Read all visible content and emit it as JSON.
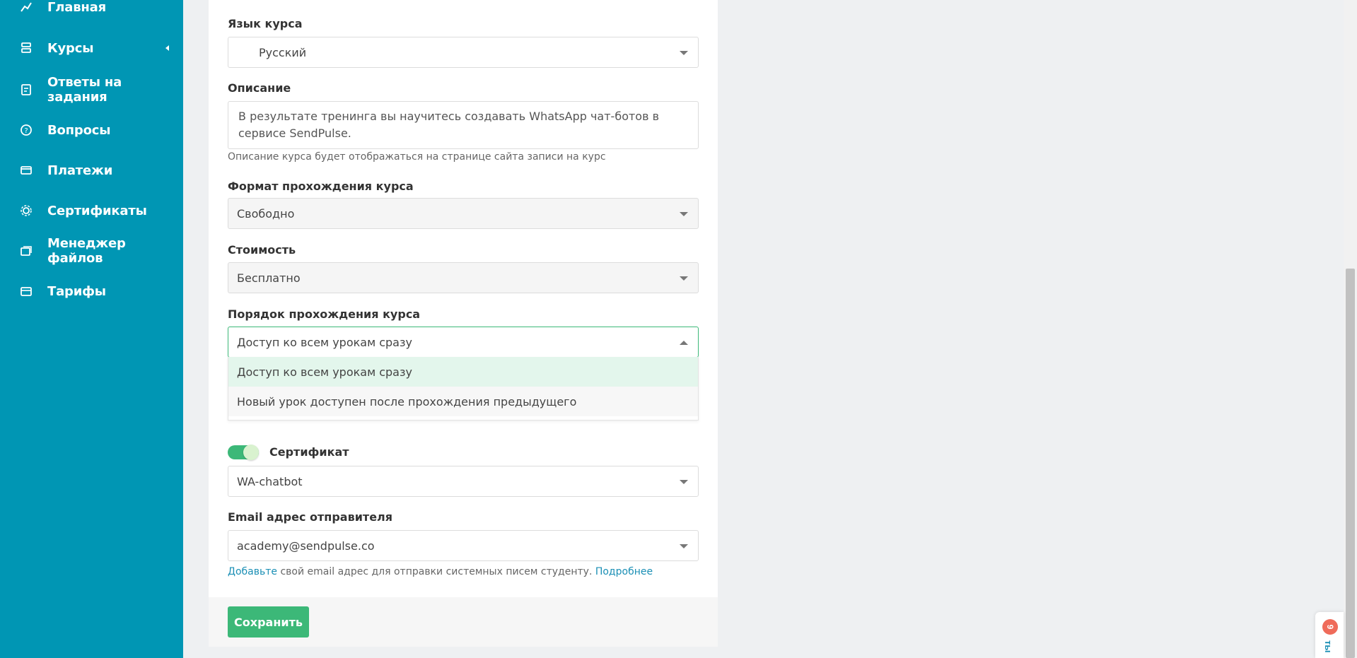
{
  "sidebar": {
    "items": [
      {
        "label": "Главная",
        "icon": "chart-line-icon"
      },
      {
        "label": "Курсы",
        "icon": "courses-icon"
      },
      {
        "label": "Ответы на задания",
        "icon": "answers-icon"
      },
      {
        "label": "Вопросы",
        "icon": "question-icon"
      },
      {
        "label": "Платежи",
        "icon": "payments-icon"
      },
      {
        "label": "Сертификаты",
        "icon": "certificate-icon"
      },
      {
        "label": "Менеджер файлов",
        "icon": "files-icon"
      },
      {
        "label": "Тарифы",
        "icon": "tariffs-icon"
      }
    ]
  },
  "form": {
    "language": {
      "label": "Язык курса",
      "value": "Русский"
    },
    "description": {
      "label": "Описание",
      "value": "В результате тренинга вы научитесь создавать WhatsApp чат-ботов в сервисе SendPulse.",
      "hint": "Описание курса будет отображаться на странице сайта записи на курс"
    },
    "format": {
      "label": "Формат прохождения курса",
      "value": "Свободно"
    },
    "price": {
      "label": "Стоимость",
      "value": "Бесплатно"
    },
    "order": {
      "label": "Порядок прохождения курса",
      "value": "Доступ ко всем урокам сразу",
      "options": [
        "Доступ ко всем урокам сразу",
        "Новый урок доступен после прохождения предыдущего"
      ]
    },
    "certificate": {
      "label": "Сертификат",
      "enabled": true,
      "value": "WA-chatbot"
    },
    "sender": {
      "label": "Email адрес отправителя",
      "value": "academy@sendpulse.co",
      "hint_link_add": "Добавьте",
      "hint_text": " свой email адрес для отправки системных писем студенту. ",
      "hint_link_more": "Подробнее"
    },
    "save_label": "Сохранить"
  },
  "chat_widget": {
    "badge": "9",
    "label": "ты"
  },
  "colors": {
    "sidebar": "#0096b4",
    "accent_green": "#3cb878",
    "link": "#1b8fb5",
    "badge": "#ef6b5a"
  }
}
